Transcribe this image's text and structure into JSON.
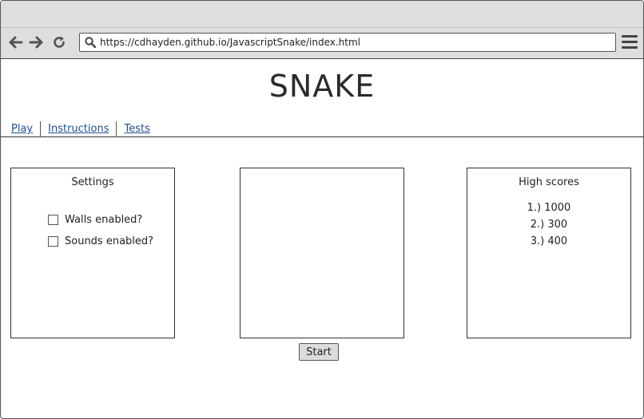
{
  "browser": {
    "url": "https://cdhayden.github.io/JavascriptSnake/index.html",
    "icons": [
      "back-arrow-icon",
      "forward-arrow-icon",
      "reload-icon",
      "search-icon",
      "hamburger-menu-icon"
    ]
  },
  "page": {
    "title": "SNAKE",
    "nav": [
      {
        "label": "Play"
      },
      {
        "label": "Instructions"
      },
      {
        "label": "Tests"
      }
    ]
  },
  "settings": {
    "title": "Settings",
    "options": [
      {
        "label": "Walls enabled?",
        "checked": false
      },
      {
        "label": "Sounds enabled?",
        "checked": false
      }
    ]
  },
  "high_scores": {
    "title": "High scores",
    "entries": [
      "1.) 1000",
      "2.) 300",
      "3.) 400"
    ]
  },
  "game": {
    "start_label": "Start"
  }
}
